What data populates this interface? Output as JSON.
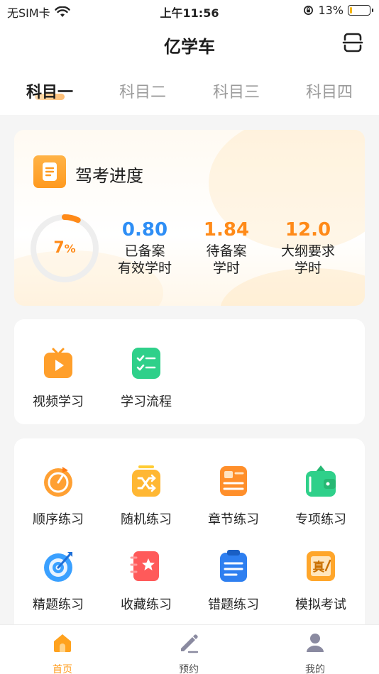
{
  "status_bar": {
    "carrier": "无SIM卡",
    "time": "上午11:56",
    "battery": "13%",
    "battery_level": 0.13
  },
  "header": {
    "title": "亿学车"
  },
  "subject_tabs": [
    {
      "label": "科目一",
      "active": true
    },
    {
      "label": "科目二",
      "active": false
    },
    {
      "label": "科目三",
      "active": false
    },
    {
      "label": "科目四",
      "active": false
    }
  ],
  "progress_card": {
    "title": "驾考进度",
    "percent_number": "7",
    "percent_sign": "%",
    "progress": 0.07,
    "stats": [
      {
        "value": "0.80",
        "line1": "已备案",
        "line2": "有效学时",
        "color": "#2e8ef5"
      },
      {
        "value": "1.84",
        "line1": "待备案",
        "line2": "学时",
        "color": "#ff8a18"
      },
      {
        "value": "12.0",
        "line1": "大纲要求",
        "line2": "学时",
        "color": "#ff8a18"
      }
    ]
  },
  "study": {
    "items": [
      {
        "label": "视频学习",
        "icon": "tv-play-icon"
      },
      {
        "label": "学习流程",
        "icon": "checklist-icon"
      }
    ]
  },
  "practice": {
    "items": [
      {
        "label": "顺序练习",
        "icon": "sequential-icon"
      },
      {
        "label": "随机练习",
        "icon": "shuffle-icon"
      },
      {
        "label": "章节练习",
        "icon": "chapter-icon"
      },
      {
        "label": "专项练习",
        "icon": "special-icon"
      },
      {
        "label": "精题练习",
        "icon": "target-icon"
      },
      {
        "label": "收藏练习",
        "icon": "star-notebook-icon"
      },
      {
        "label": "错题练习",
        "icon": "clipboard-icon"
      },
      {
        "label": "模拟考试",
        "icon": "exam-icon"
      }
    ]
  },
  "tab_bar": [
    {
      "label": "首页",
      "icon": "home-icon",
      "active": true
    },
    {
      "label": "预约",
      "icon": "pencil-icon",
      "active": false
    },
    {
      "label": "我的",
      "icon": "user-icon",
      "active": false
    }
  ],
  "colors": {
    "accent_orange": "#ff8a18",
    "blue": "#2e8ef5",
    "green": "#2fd08a"
  }
}
